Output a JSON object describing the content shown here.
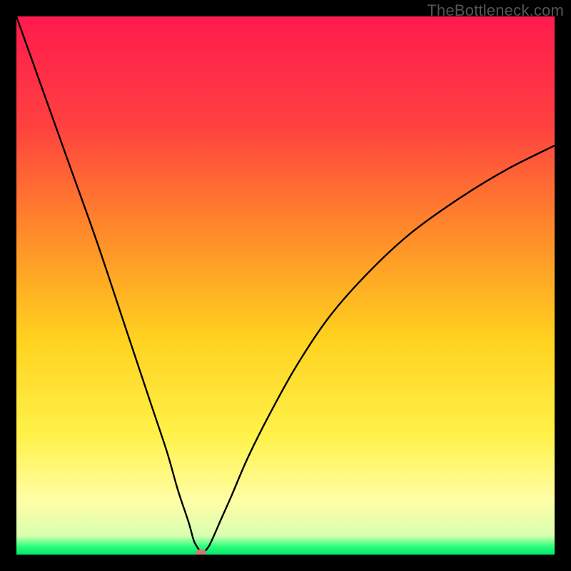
{
  "watermark": "TheBottleneck.com",
  "chart_data": {
    "type": "line",
    "title": "",
    "xlabel": "",
    "ylabel": "",
    "xlim": [
      0,
      100
    ],
    "ylim": [
      0,
      100
    ],
    "grid": false,
    "legend": false,
    "background": {
      "note": "Vertical gradient from red-pink at top through orange and yellow to pale yellow, with a thin bright green strip at the very bottom.",
      "stops": [
        {
          "offset": 0.0,
          "color": "#ff1a4d"
        },
        {
          "offset": 0.2,
          "color": "#ff4040"
        },
        {
          "offset": 0.4,
          "color": "#ff8a2a"
        },
        {
          "offset": 0.6,
          "color": "#ffd21f"
        },
        {
          "offset": 0.78,
          "color": "#fff24a"
        },
        {
          "offset": 0.9,
          "color": "#fffea6"
        },
        {
          "offset": 0.965,
          "color": "#d8ffb0"
        },
        {
          "offset": 0.985,
          "color": "#2bff7a"
        },
        {
          "offset": 1.0,
          "color": "#00e86b"
        }
      ]
    },
    "curve": {
      "note": "Single black V-shaped curve; left branch steep and nearly straight, right branch broader and concave. Dips to y≈0 near x≈34.",
      "x": [
        0,
        5,
        10,
        15,
        20,
        25,
        28,
        30,
        32,
        33,
        34,
        34.5,
        35,
        36,
        38,
        40,
        43,
        47,
        52,
        58,
        65,
        73,
        82,
        91,
        100
      ],
      "y": [
        100,
        86,
        72,
        58,
        43,
        28,
        19,
        12,
        6,
        2.5,
        0.8,
        0.2,
        0.6,
        2,
        6.5,
        11,
        18,
        26,
        35,
        44,
        52,
        59.5,
        66,
        71.5,
        76
      ]
    },
    "marker": {
      "note": "Small rounded salmon-pink dot at the curve's minimum.",
      "x": 34.3,
      "y": 0.3,
      "color": "#cc7a75"
    }
  }
}
